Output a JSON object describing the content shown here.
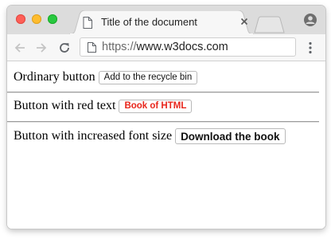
{
  "browser": {
    "tab": {
      "title": "Title of the document",
      "doc_icon": "document-icon",
      "close_icon": "close-icon"
    },
    "new_tab_icon": "new-tab-icon",
    "profile_icon": "profile-icon",
    "nav": {
      "back_icon": "back-arrow-icon",
      "forward_icon": "forward-arrow-icon",
      "reload_icon": "reload-icon"
    },
    "address_bar": {
      "scheme": "https://",
      "host": "www.w3docs.com",
      "page_icon": "page-icon"
    },
    "menu_icon": "kebab-menu-icon",
    "traffic_lights": {
      "close_color": "#fe5f57",
      "minimize_color": "#febc2e",
      "zoom_color": "#28c840"
    }
  },
  "page": {
    "rows": [
      {
        "label": "Ordinary button",
        "button": "Add to the recycle bin"
      },
      {
        "label": "Button with red text",
        "button": "Book of HTML",
        "button_color": "#e8261c"
      },
      {
        "label": "Button with increased font size",
        "button": "Download the book"
      }
    ]
  }
}
